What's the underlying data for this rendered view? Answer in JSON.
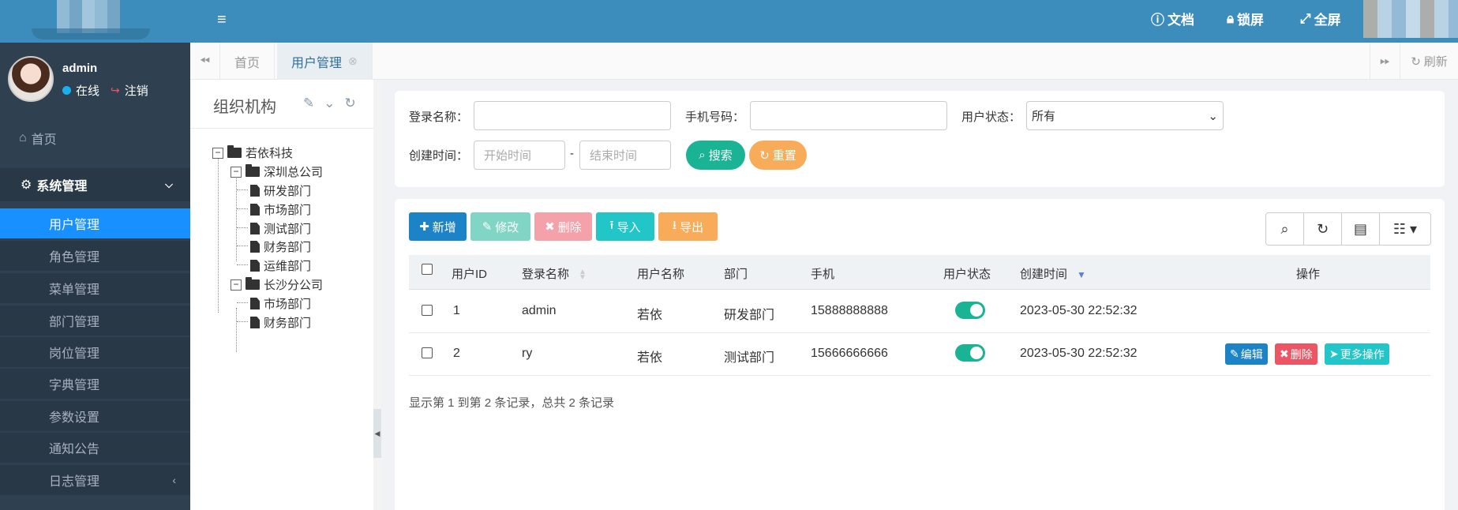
{
  "colors": {
    "sidebar_bg": "#2f4050",
    "topbar_bg": "#3c8dbc",
    "active_menu": "#1890ff",
    "btn_primary": "#1c84c6",
    "btn_success": "#1ab394",
    "btn_danger": "#ed5565",
    "btn_info": "#23c6c8",
    "btn_warning": "#f8ac59"
  },
  "sidebar": {
    "user": {
      "name": "admin",
      "status": "在线",
      "logout": "注销"
    },
    "home": "首页",
    "group": {
      "label": "系统管理"
    },
    "items": [
      {
        "label": "用户管理",
        "active": true
      },
      {
        "label": "角色管理"
      },
      {
        "label": "菜单管理"
      },
      {
        "label": "部门管理"
      },
      {
        "label": "岗位管理"
      },
      {
        "label": "字典管理"
      },
      {
        "label": "参数设置"
      },
      {
        "label": "通知公告"
      },
      {
        "label": "日志管理"
      }
    ]
  },
  "topbar": {
    "docs": "文档",
    "lock": "锁屏",
    "fullscreen": "全屏"
  },
  "tabs": {
    "items": [
      {
        "label": "首页"
      },
      {
        "label": "用户管理",
        "active": true
      }
    ],
    "refresh": "刷新"
  },
  "org": {
    "title": "组织机构",
    "tree": {
      "root": "若依科技",
      "branch1": "深圳总公司",
      "branch1_children": [
        "研发部门",
        "市场部门",
        "测试部门",
        "财务部门",
        "运维部门"
      ],
      "branch2": "长沙分公司",
      "branch2_children": [
        "市场部门",
        "财务部门"
      ]
    }
  },
  "search": {
    "login_name_label": "登录名称：",
    "phone_label": "手机号码：",
    "status_label": "用户状态：",
    "status_value": "所有",
    "create_time_label": "创建时间：",
    "start_placeholder": "开始时间",
    "end_placeholder": "结束时间",
    "dash": "-",
    "search_btn": "搜索",
    "reset_btn": "重置"
  },
  "toolbar": {
    "add": "新增",
    "edit": "修改",
    "delete": "删除",
    "import": "导入",
    "export": "导出"
  },
  "table": {
    "headers": [
      "用户ID",
      "登录名称",
      "用户名称",
      "部门",
      "手机",
      "用户状态",
      "创建时间",
      "操作"
    ],
    "rows": [
      {
        "id": "1",
        "login": "admin",
        "name": "若依",
        "dept": "研发部门",
        "phone": "15888888888",
        "status_on": true,
        "created": "2023-05-30 22:52:32"
      },
      {
        "id": "2",
        "login": "ry",
        "name": "若依",
        "dept": "测试部门",
        "phone": "15666666666",
        "status_on": true,
        "created": "2023-05-30 22:52:32"
      }
    ],
    "ops": {
      "edit": "编辑",
      "delete": "删除",
      "more": "更多操作"
    },
    "pager": "显示第 1 到第 2 条记录，总共 2 条记录"
  }
}
